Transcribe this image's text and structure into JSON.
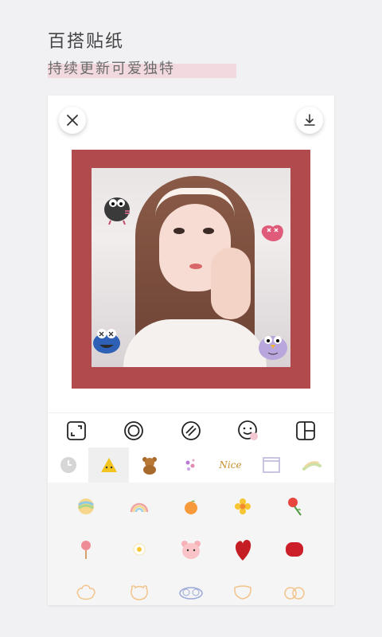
{
  "header": {
    "title": "百搭贴纸",
    "subtitle": "持续更新可爱独特"
  },
  "topbar": {
    "close_icon": "close-icon",
    "download_icon": "download-icon"
  },
  "photo": {
    "frame_color": "#b04a4d"
  },
  "toolbar": {
    "tools": [
      "crop-icon",
      "frame-ring-icon",
      "filter-icon",
      "sticker-icon",
      "layout-icon"
    ]
  },
  "categories": {
    "items": [
      "recent-clock-icon",
      "yellow-triangle-sticker",
      "teddy-bear-sticker",
      "flower-dots-sticker",
      "Nice",
      "window-frame-sticker",
      "brush-stroke-sticker"
    ],
    "nice_label": "Nice",
    "active_index": 1
  },
  "sticker_grid": {
    "rows": [
      [
        "rainbow-ball-sticker",
        "rainbow-sticker",
        "orange-sticker",
        "yellow-flower-sticker",
        "rose-sticker"
      ],
      [
        "lollipop-sticker",
        "daisy-sticker",
        "pink-bear-sticker",
        "red-heart-sticker",
        "red-blob-sticker"
      ],
      [
        "cloud-face-sticker",
        "bear-face-sticker",
        "blue-face-sticker",
        "smile-face-sticker",
        "twin-face-sticker"
      ]
    ]
  }
}
